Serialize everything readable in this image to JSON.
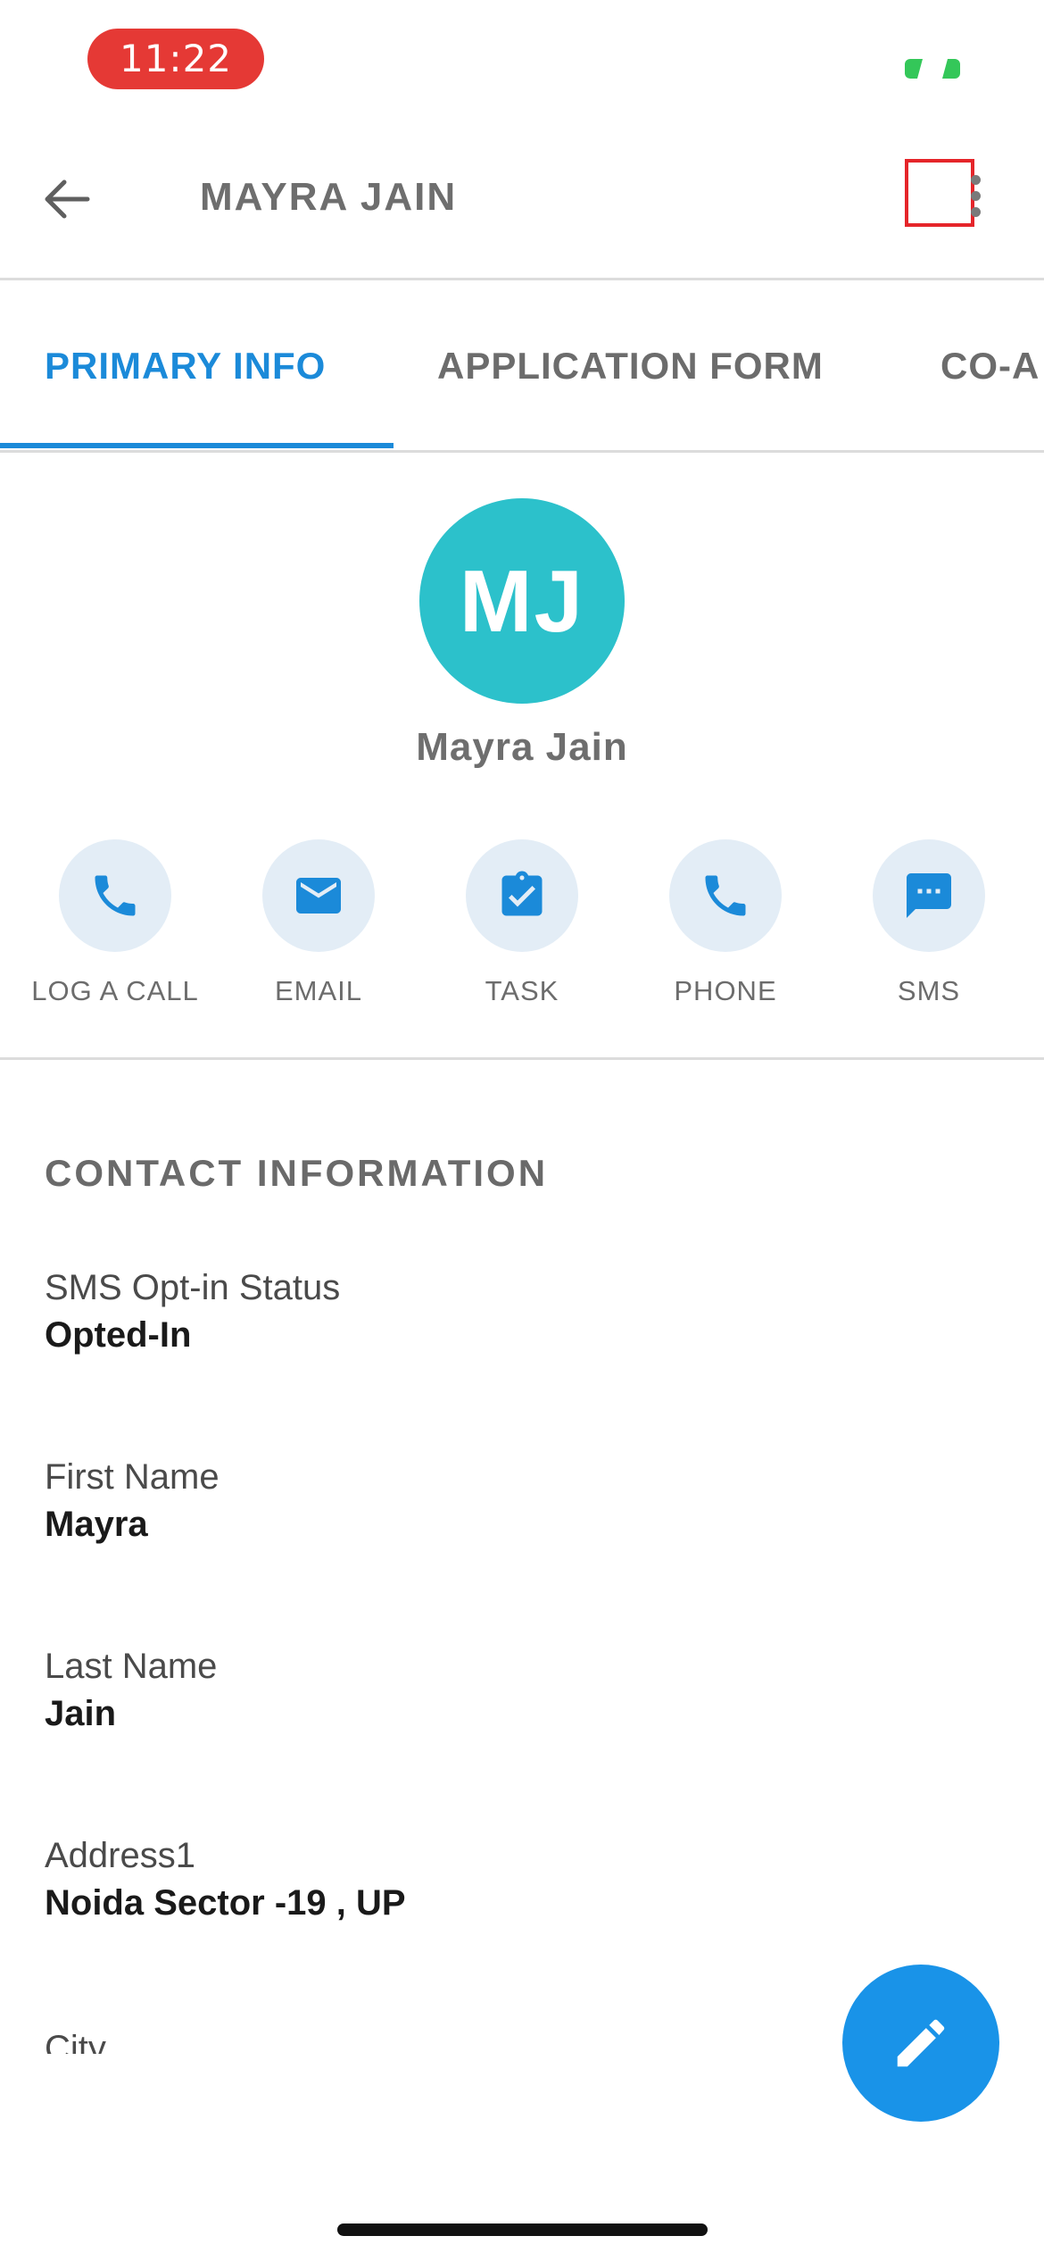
{
  "status_bar": {
    "time": "11:22"
  },
  "header": {
    "title": "MAYRA JAIN"
  },
  "tabs": [
    {
      "label": "PRIMARY INFO",
      "active": true
    },
    {
      "label": "APPLICATION FORM",
      "active": false
    },
    {
      "label": "CO-A",
      "active": false
    }
  ],
  "profile": {
    "initials": "MJ",
    "name": "Mayra Jain"
  },
  "actions": [
    {
      "label": "LOG A CALL",
      "icon": "phone-icon"
    },
    {
      "label": "EMAIL",
      "icon": "mail-icon"
    },
    {
      "label": "TASK",
      "icon": "clipboard-check-icon"
    },
    {
      "label": "PHONE",
      "icon": "phone-icon"
    },
    {
      "label": "SMS",
      "icon": "message-icon"
    }
  ],
  "contact": {
    "title": "CONTACT INFORMATION",
    "fields": [
      {
        "label": "SMS Opt-in Status",
        "value": "Opted-In"
      },
      {
        "label": "First Name",
        "value": "Mayra"
      },
      {
        "label": "Last Name",
        "value": "Jain"
      },
      {
        "label": "Address1",
        "value": "Noida Sector -19 , UP"
      },
      {
        "label": "City"
      }
    ]
  },
  "colors": {
    "accent": "#1b8ad9",
    "avatar": "#2cc1cb",
    "fab": "#1993e8",
    "status_pill": "#e53935",
    "action_bg": "#e3edf6"
  }
}
